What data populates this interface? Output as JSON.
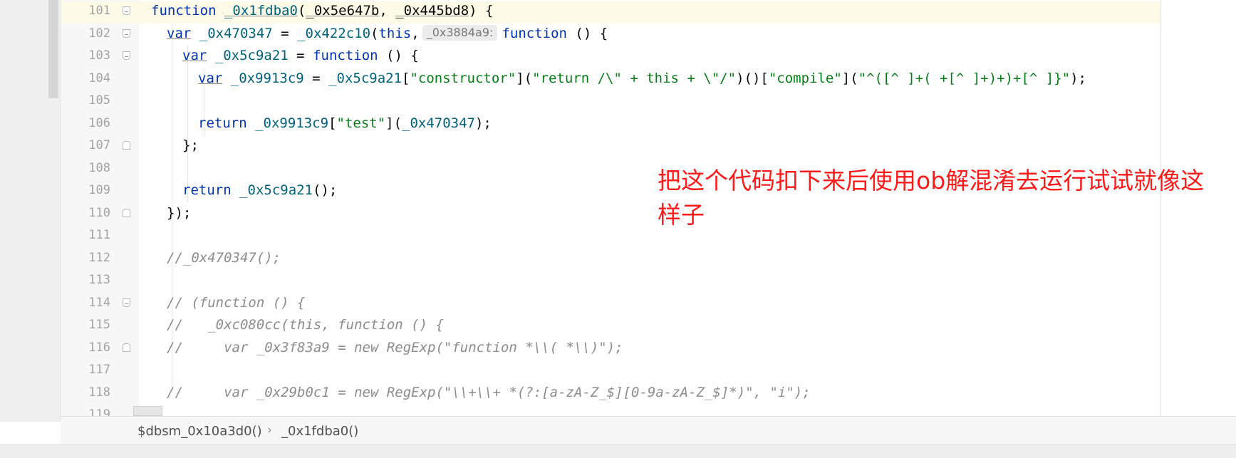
{
  "editor": {
    "lines": [
      {
        "num": "101",
        "fold": "open"
      },
      {
        "num": "102",
        "fold": "open"
      },
      {
        "num": "103",
        "fold": "open"
      },
      {
        "num": "104",
        "fold": ""
      },
      {
        "num": "105",
        "fold": ""
      },
      {
        "num": "106",
        "fold": ""
      },
      {
        "num": "107",
        "fold": "close"
      },
      {
        "num": "108",
        "fold": ""
      },
      {
        "num": "109",
        "fold": ""
      },
      {
        "num": "110",
        "fold": "close"
      },
      {
        "num": "111",
        "fold": ""
      },
      {
        "num": "112",
        "fold": ""
      },
      {
        "num": "113",
        "fold": ""
      },
      {
        "num": "114",
        "fold": "open"
      },
      {
        "num": "115",
        "fold": ""
      },
      {
        "num": "116",
        "fold": "close"
      },
      {
        "num": "117",
        "fold": ""
      },
      {
        "num": "118",
        "fold": ""
      },
      {
        "num": "119",
        "fold": ""
      }
    ],
    "tokens": {
      "l101_kw": "function",
      "l101_name": "_0x1fdba0",
      "l101_p1": "_0x5e647b",
      "l101_p2": "_0x445bd8",
      "l102_kw": "var",
      "l102_var": "_0x470347",
      "l102_call": "_0x422c10",
      "l102_this": "this",
      "l102_hint": "_0x3884a9:",
      "l102_fn": "function",
      "l103_kw": "var",
      "l103_var": "_0x5c9a21",
      "l103_fn": "function",
      "l104_kw": "var",
      "l104_var": "_0x9913c9",
      "l104_obj": "_0x5c9a21",
      "l104_s1": "\"constructor\"",
      "l104_s2": "\"return /\\\" + this + \\\"/\"",
      "l104_s3": "\"compile\"",
      "l104_s4": "\"^([^ ]+( +[^ ]+)+)+[^ ]}\"",
      "l106_kw": "return",
      "l106_obj": "_0x9913c9",
      "l106_s": "\"test\"",
      "l106_arg": "_0x470347",
      "l107": "};",
      "l109_kw": "return",
      "l109_call": "_0x5c9a21",
      "l110": "});",
      "l112": "//_0x470347();",
      "l114": "// (function () {",
      "l115": "//   _0xc080cc(this, function () {",
      "l116": "//     var _0x3f83a9 = new RegExp(\"function *\\\\( *\\\\)\");",
      "l118": "//     var _0x29b0c1 = new RegExp(\"\\\\+\\\\+ *(?:[a-zA-Z_$][0-9a-zA-Z_$]*)\", \"i\");"
    }
  },
  "annotation": {
    "text": "把这个代码扣下来后使用ob解混淆去运行试试就像这样子"
  },
  "breadcrumb": {
    "items": [
      "$dbsm_0x10a3d0()",
      "_0x1fdba0()"
    ],
    "separator": "›"
  },
  "colors": {
    "annotation": "#ff1a1a",
    "keyword": "#0033b3",
    "string": "#067d17",
    "comment": "#8c8c8c",
    "current_line": "#fdfbe8"
  }
}
